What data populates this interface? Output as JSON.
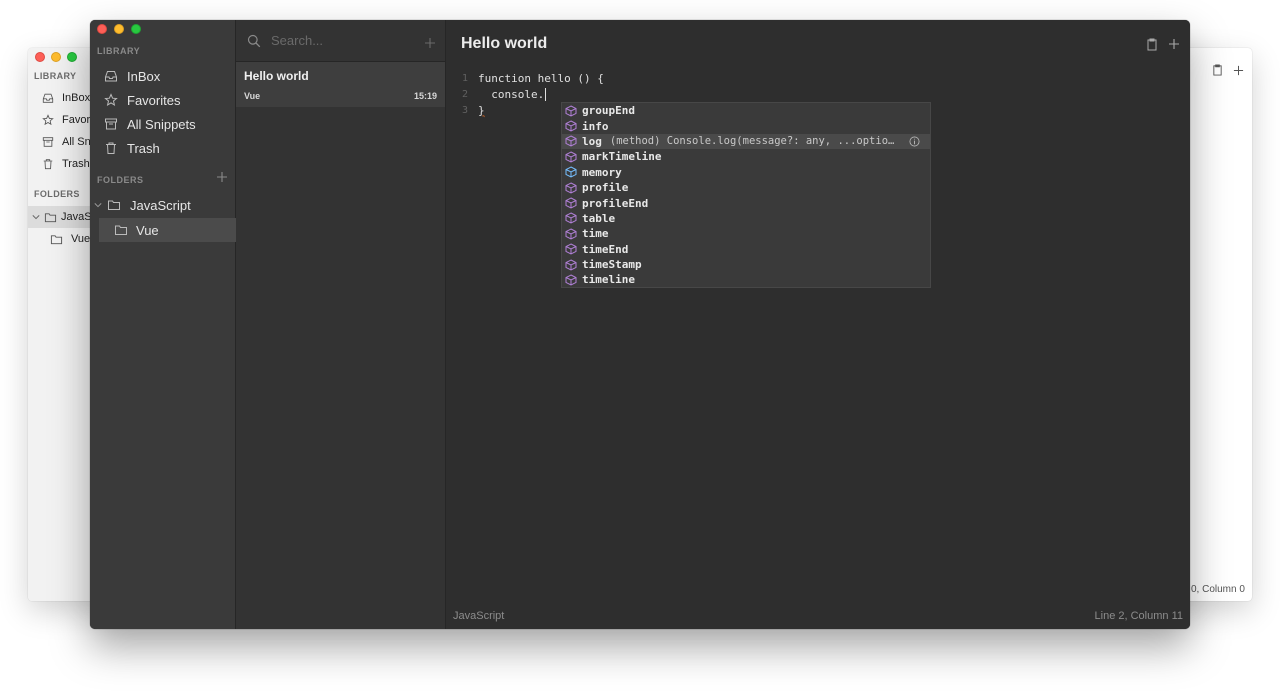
{
  "back_window": {
    "library_heading": "LIBRARY",
    "nav": [
      {
        "label": "InBox",
        "icon": "inbox-icon"
      },
      {
        "label": "Favor",
        "icon": "star-icon"
      },
      {
        "label": "All Sn",
        "icon": "archive-icon"
      },
      {
        "label": "Trash",
        "icon": "trash-icon"
      }
    ],
    "folders_heading": "FOLDERS",
    "folders": [
      {
        "label": "JavaS"
      },
      {
        "label": "Vue"
      }
    ],
    "status_text": "0, Column 0"
  },
  "library": {
    "heading": "LIBRARY",
    "nav": [
      {
        "label": "InBox",
        "icon": "inbox-icon"
      },
      {
        "label": "Favorites",
        "icon": "star-icon"
      },
      {
        "label": "All Snippets",
        "icon": "archive-icon"
      },
      {
        "label": "Trash",
        "icon": "trash-icon"
      }
    ]
  },
  "folders": {
    "heading": "FOLDERS",
    "items": [
      {
        "label": "JavaScript",
        "expanded": true
      },
      {
        "label": "Vue",
        "selected": true
      }
    ]
  },
  "search": {
    "placeholder": "Search..."
  },
  "snippets": [
    {
      "title": "Hello world",
      "folder": "Vue",
      "time": "15:19"
    }
  ],
  "editor": {
    "title": "Hello world",
    "lines": [
      {
        "number": "1",
        "keyword": "function",
        "rest": " hello () {"
      },
      {
        "number": "2",
        "text": "  console."
      },
      {
        "number": "3",
        "text": "}"
      }
    ]
  },
  "suggestions": {
    "items": [
      {
        "label": "groupEnd"
      },
      {
        "label": "info"
      },
      {
        "label": "log",
        "detail": "(method) Console.log(message?: any, ...optiona…",
        "selected": true
      },
      {
        "label": "markTimeline"
      },
      {
        "label": "memory",
        "kind": "property"
      },
      {
        "label": "profile"
      },
      {
        "label": "profileEnd"
      },
      {
        "label": "table"
      },
      {
        "label": "time"
      },
      {
        "label": "timeEnd"
      },
      {
        "label": "timeStamp"
      },
      {
        "label": "timeline"
      }
    ],
    "method_icon_color": "#b180d7",
    "property_icon_color": "#75beff"
  },
  "statusbar": {
    "language": "JavaScript",
    "cursor": "Line 2, Column 11"
  }
}
